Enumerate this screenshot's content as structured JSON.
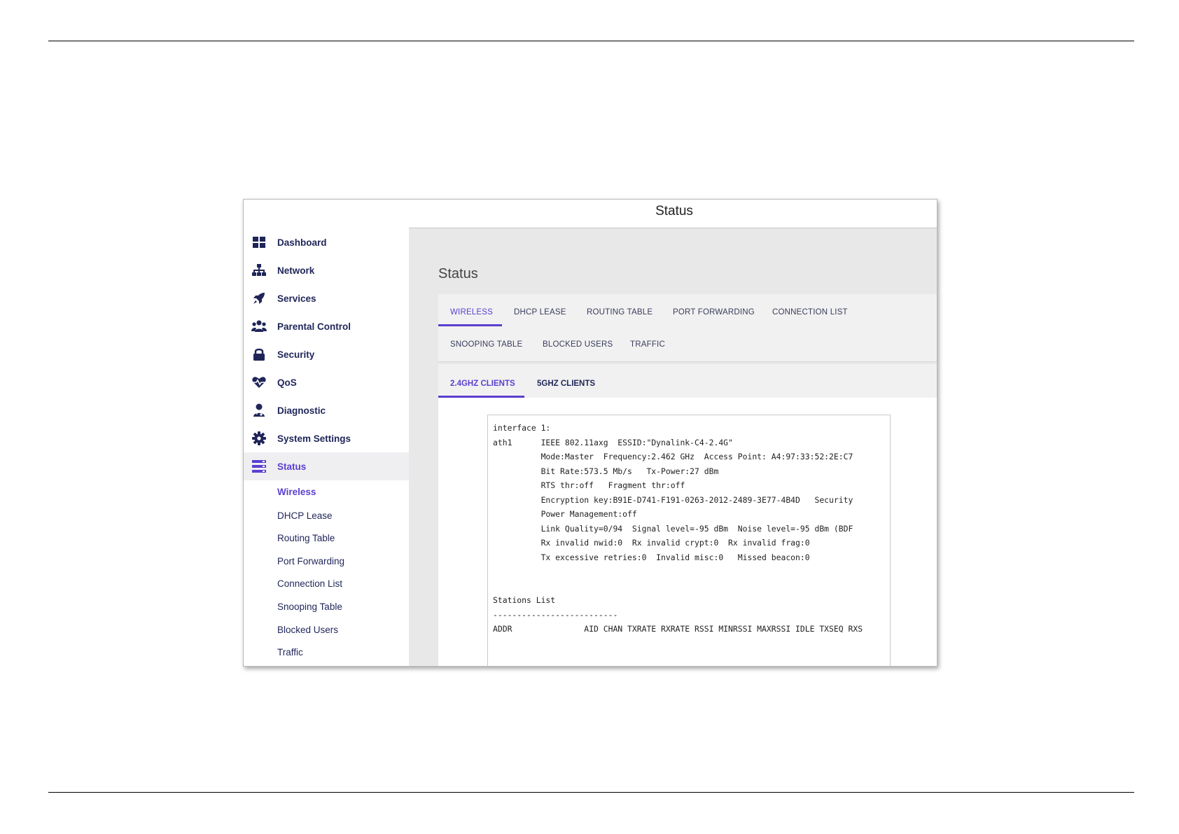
{
  "window": {
    "title": "Status"
  },
  "sidebar": {
    "items": [
      {
        "label": "Dashboard",
        "icon": "dashboard-icon"
      },
      {
        "label": "Network",
        "icon": "network-icon"
      },
      {
        "label": "Services",
        "icon": "rocket-icon"
      },
      {
        "label": "Parental Control",
        "icon": "users-icon"
      },
      {
        "label": "Security",
        "icon": "lock-icon"
      },
      {
        "label": "QoS",
        "icon": "heartbeat-icon"
      },
      {
        "label": "Diagnostic",
        "icon": "doctor-icon"
      },
      {
        "label": "System Settings",
        "icon": "gear-icon"
      },
      {
        "label": "Status",
        "icon": "server-icon",
        "active": true
      }
    ],
    "sub_items": [
      {
        "label": "Wireless",
        "active": true
      },
      {
        "label": "DHCP Lease"
      },
      {
        "label": "Routing Table"
      },
      {
        "label": "Port Forwarding"
      },
      {
        "label": "Connection List"
      },
      {
        "label": "Snooping Table"
      },
      {
        "label": "Blocked Users"
      },
      {
        "label": "Traffic"
      }
    ]
  },
  "main": {
    "page_title": "Status",
    "tabs": [
      {
        "label": "WIRELESS",
        "active": true
      },
      {
        "label": "DHCP LEASE"
      },
      {
        "label": "ROUTING TABLE"
      },
      {
        "label": "PORT FORWARDING"
      },
      {
        "label": "CONNECTION LIST"
      },
      {
        "label": "SNOOPING TABLE"
      },
      {
        "label": "BLOCKED USERS"
      },
      {
        "label": "TRAFFIC"
      }
    ],
    "subtabs": [
      {
        "label": "2.4GHZ CLIENTS",
        "active": true
      },
      {
        "label": "5GHZ CLIENTS"
      }
    ],
    "console_lines": [
      "interface 1:",
      "ath1      IEEE 802.11axg  ESSID:\"Dynalink-C4-2.4G\"",
      "          Mode:Master  Frequency:2.462 GHz  Access Point: A4:97:33:52:2E:C7",
      "          Bit Rate:573.5 Mb/s   Tx-Power:27 dBm",
      "          RTS thr:off   Fragment thr:off",
      "          Encryption key:B91E-D741-F191-0263-2012-2489-3E77-4B4D   Security",
      "          Power Management:off",
      "          Link Quality=0/94  Signal level=-95 dBm  Noise level=-95 dBm (BDF",
      "          Rx invalid nwid:0  Rx invalid crypt:0  Rx invalid frag:0",
      "          Tx excessive retries:0  Invalid misc:0   Missed beacon:0",
      "",
      "",
      "Stations List",
      "--------------------------",
      "ADDR               AID CHAN TXRATE RXRATE RSSI MINRSSI MAXRSSI IDLE TXSEQ RXS"
    ]
  },
  "colors": {
    "accent": "#5b3fcf",
    "nav_text": "#1f2558",
    "content_bg": "#e8e8e8"
  }
}
